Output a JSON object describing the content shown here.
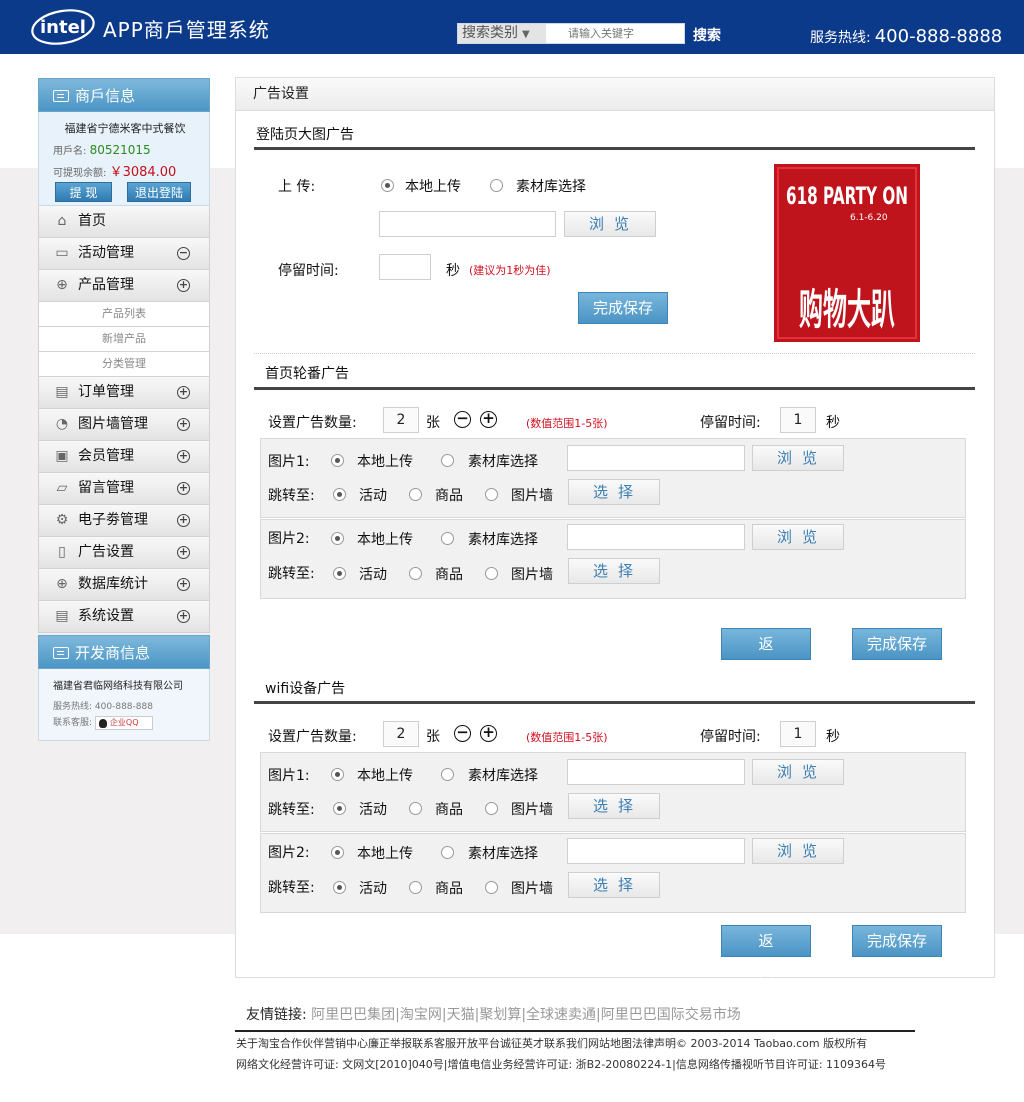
{
  "header": {
    "logo_text": "intel",
    "app_title": "APP商戶管理系统",
    "search_category": "搜索类别",
    "search_placeholder": "请输入关键字",
    "search_button": "搜索",
    "hotline_label": "服务热线:",
    "hotline_number": "400-888-8888"
  },
  "sidebar": {
    "merchant_header": "商戶信息",
    "merchant_name": "福建省宁德米客中式餐饮",
    "username_label": "用戶名:",
    "username": "80521015",
    "balance_label": "可提现余额:",
    "balance": "￥3084.00",
    "withdraw_button": "提  现",
    "logout_button": "退出登陆",
    "nav": [
      {
        "label": "首页",
        "icon": "home-icon",
        "toggle": ""
      },
      {
        "label": "活动管理",
        "icon": "monitor-icon",
        "toggle": "−"
      },
      {
        "label": "产品管理",
        "icon": "globe-icon",
        "toggle": "+"
      },
      {
        "label": "订单管理",
        "icon": "inbox-icon",
        "toggle": "+"
      },
      {
        "label": "图片墙管理",
        "icon": "mouse-icon",
        "toggle": "+"
      },
      {
        "label": "会员管理",
        "icon": "chat-icon",
        "toggle": "+"
      },
      {
        "label": "留言管理",
        "icon": "folder-icon",
        "toggle": "+"
      },
      {
        "label": "电子劵管理",
        "icon": "gears-icon",
        "toggle": "+"
      },
      {
        "label": "广告设置",
        "icon": "document-icon",
        "toggle": "+"
      },
      {
        "label": "数据库统计",
        "icon": "globe-icon",
        "toggle": "+"
      },
      {
        "label": "系统设置",
        "icon": "inbox-icon",
        "toggle": "+"
      }
    ],
    "sub_items": [
      "产品列表",
      "新增产品",
      "分类管理"
    ],
    "developer_header": "开发商信息",
    "developer_name": "福建省君临网络科技有限公司",
    "dev_hotline_label": "服务热线:",
    "dev_hotline": "400-888-888",
    "dev_contact_label": "联系客服:",
    "dev_qq": "企业QQ"
  },
  "main": {
    "panel_title": "广告设置",
    "login_ad": {
      "title": "登陆页大图广告",
      "upload_label": "上    传:",
      "local_upload": "本地上传",
      "library_select": "素材库选择",
      "browse_button": "浏览",
      "stay_label": "停留时间:",
      "seconds_unit": "秒",
      "hint": "(建议为1秒为佳)",
      "save_button": "完成保存",
      "image_text_top": "618 PARTY ON",
      "image_text_date": "6.1-6.20",
      "image_text_main": "购物大趴"
    },
    "carousels": [
      {
        "title": "首页轮番广告",
        "count_label": "设置广告数量:",
        "count": "2",
        "count_unit": "张",
        "range_hint": "(数值范围1-5张)",
        "stay_label": "停留时间:",
        "stay_value": "1",
        "stay_unit": "秒",
        "images": [
          {
            "label": "图片1:",
            "local": "本地上传",
            "library": "素材库选择",
            "browse": "浏览",
            "jump_label": "跳转至:",
            "opt_activity": "活动",
            "opt_product": "商品",
            "opt_wall": "图片墙",
            "select": "选择"
          },
          {
            "label": "图片2:",
            "local": "本地上传",
            "library": "素材库选择",
            "browse": "浏览",
            "jump_label": "跳转至:",
            "opt_activity": "活动",
            "opt_product": "商品",
            "opt_wall": "图片墙",
            "select": "选择"
          }
        ],
        "back_button": "返回",
        "save_button": "完成保存"
      },
      {
        "title": "wifi设备广告",
        "count_label": "设置广告数量:",
        "count": "2",
        "count_unit": "张",
        "range_hint": "(数值范围1-5张)",
        "stay_label": "停留时间:",
        "stay_value": "1",
        "stay_unit": "秒",
        "images": [
          {
            "label": "图片1:",
            "local": "本地上传",
            "library": "素材库选择",
            "browse": "浏览",
            "jump_label": "跳转至:",
            "opt_activity": "活动",
            "opt_product": "商品",
            "opt_wall": "图片墙",
            "select": "选择"
          },
          {
            "label": "图片2:",
            "local": "本地上传",
            "library": "素材库选择",
            "browse": "浏览",
            "jump_label": "跳转至:",
            "opt_activity": "活动",
            "opt_product": "商品",
            "opt_wall": "图片墙",
            "select": "选择"
          }
        ],
        "back_button": "返回",
        "save_button": "完成保存"
      }
    ]
  },
  "footer": {
    "friend_label": "友情链接:",
    "friend_links": "阿里巴巴集团|淘宝网|天猫|聚划算|全球速卖通|阿里巴巴国际交易市场",
    "copyright": "关于淘宝合作伙伴营销中心廉正举报联系客服开放平台诚征英才联系我们网站地图法律声明© 2003-2014 Taobao.com 版权所有",
    "license": "网络文化经营许可证: 文网文[2010]040号|增值电信业务经营许可证: 浙B2-20080224-1|信息网络传播视听节目许可证: 1109364号"
  },
  "colors": {
    "header_bg": "#0c3a8a",
    "accent_blue": "#4b94c4",
    "hint_red": "#d0101e"
  }
}
